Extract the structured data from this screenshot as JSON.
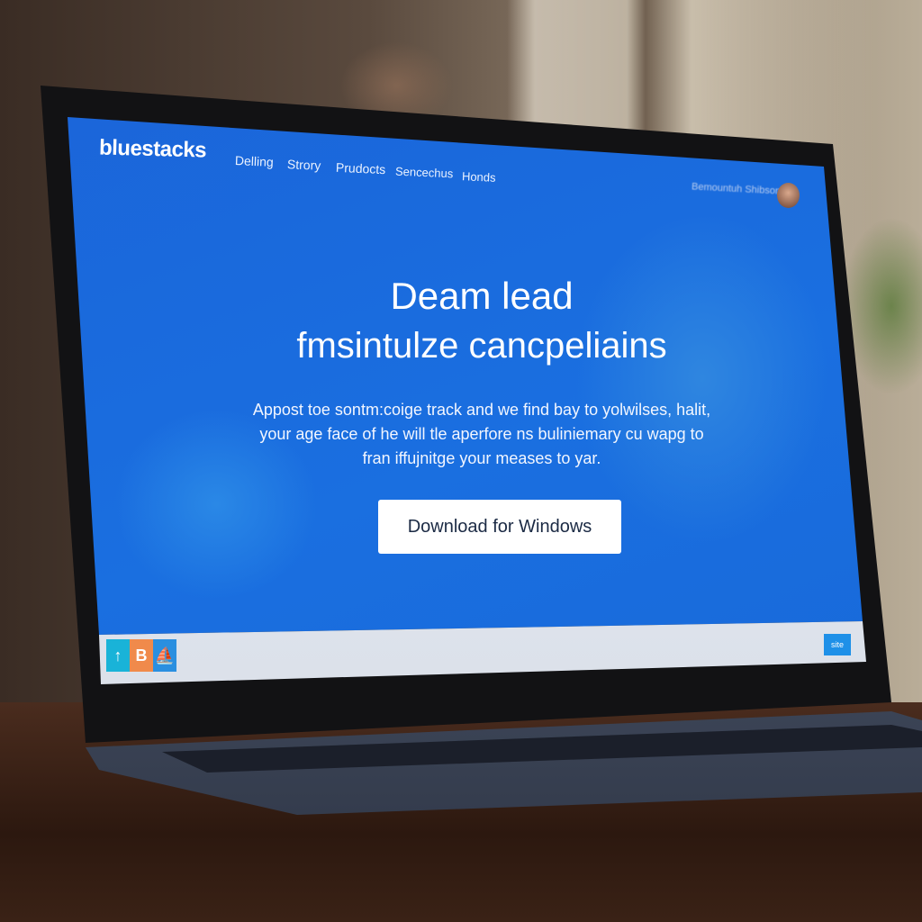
{
  "site": {
    "logo": "bluestacks",
    "nav": [
      "Delling",
      "Strory",
      "Prudocts",
      "Sencechus",
      "Honds"
    ],
    "user_name": "Bemountuh Shibson",
    "hero_title_line1": "Deam lead",
    "hero_title_line2": "fmsintulze cancpeliains",
    "hero_description": "Appost toe sontm:coige track and we find bay to yolwilses, halit, your age face of he will tle aperfore ns buliniemary cu wapg to fran iffujnitge your meases to yar.",
    "cta_label": "Download for Windows",
    "accent": "#1a6fe0"
  },
  "taskbar": {
    "icons": [
      {
        "name": "app-icon",
        "glyph": "↑",
        "color": "#19b3d8"
      },
      {
        "name": "b-app-icon",
        "glyph": "B",
        "color": "#f08a4b"
      },
      {
        "name": "ship-app-icon",
        "glyph": "⛵",
        "color": "#2a8fe0"
      }
    ],
    "button_label": "site"
  }
}
